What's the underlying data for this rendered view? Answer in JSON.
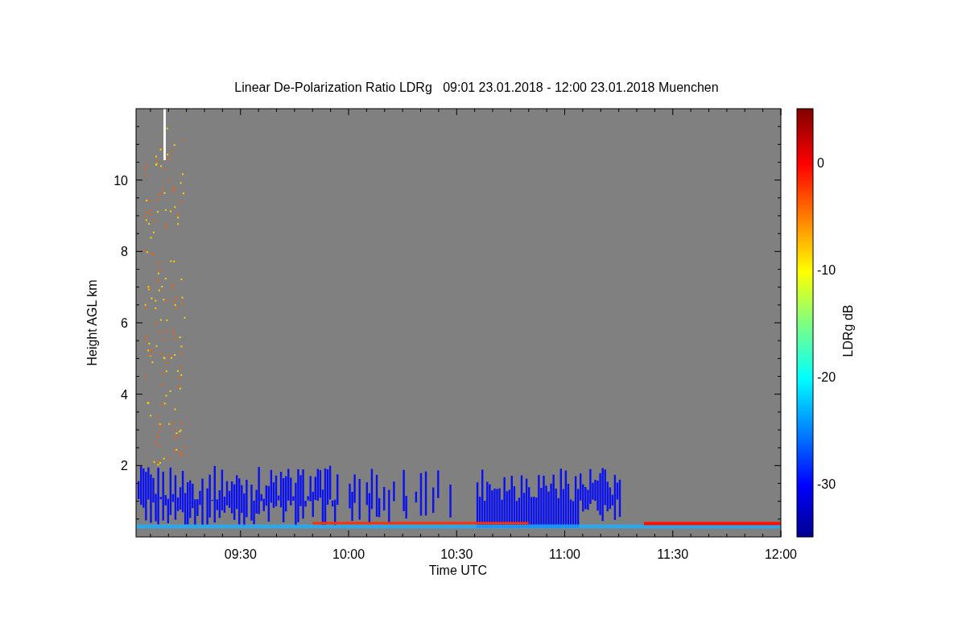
{
  "title": "Linear De-Polarization Ratio LDRg   09:01 23.01.2018 - 12:00 23.01.2018 Muenchen",
  "x_axis": {
    "label": "Time UTC",
    "ticks": [
      "09:30",
      "10:00",
      "10:30",
      "11:00",
      "11:30",
      "12:00"
    ]
  },
  "y_axis": {
    "label": "Height AGL km",
    "ticks": [
      "10",
      "8",
      "6",
      "4",
      "2"
    ]
  },
  "colorbar": {
    "label": "LDRg dB",
    "ticks": [
      "0",
      "-10",
      "-20",
      "-30"
    ]
  }
}
